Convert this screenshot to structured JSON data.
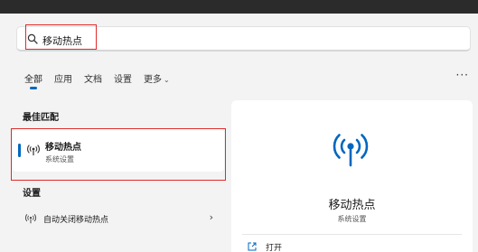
{
  "search": {
    "value": "移动热点"
  },
  "filters": {
    "tabs": [
      {
        "label": "全部"
      },
      {
        "label": "应用"
      },
      {
        "label": "文档"
      },
      {
        "label": "设置"
      },
      {
        "label": "更多"
      }
    ],
    "active": "全部",
    "more_menu": "···"
  },
  "best_match": {
    "heading": "最佳匹配",
    "title": "移动热点",
    "subtitle": "系统设置"
  },
  "settings": {
    "heading": "设置",
    "items": [
      {
        "label": "自动关闭移动热点"
      }
    ]
  },
  "detail": {
    "title": "移动热点",
    "subtitle": "系统设置",
    "action_open": "打开"
  },
  "colors": {
    "accent": "#0067c0",
    "highlight_box": "#e02b2b",
    "background": "#f3f3f3"
  }
}
